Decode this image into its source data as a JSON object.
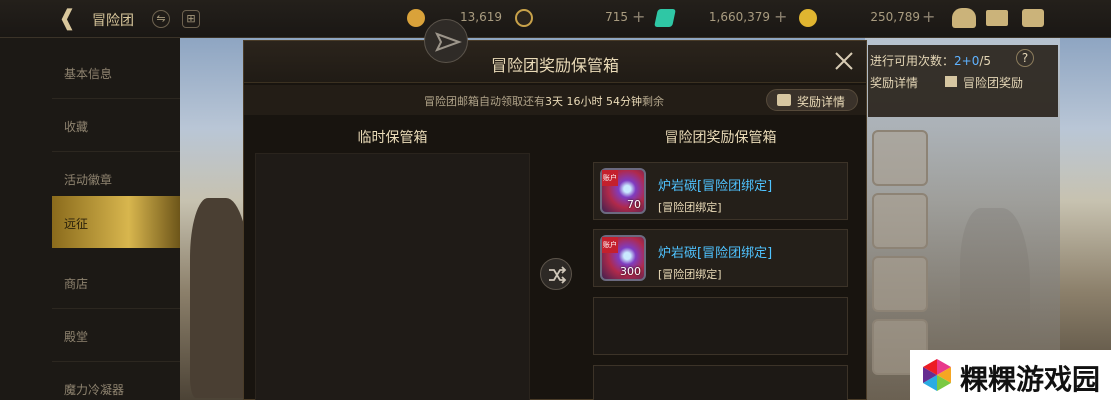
{
  "topbar": {
    "title": "冒险团",
    "currencies": [
      {
        "icon": "trophy-icon",
        "value": "13,619",
        "color": "#d9a23a"
      },
      {
        "icon": "coin-c-icon",
        "value": "715",
        "color": "#c8a24a"
      },
      {
        "icon": "crystal-icon",
        "value": "1,660,379",
        "color": "#2fc7a5"
      },
      {
        "icon": "gold-coin-icon",
        "value": "250,789",
        "color": "#e0b530"
      }
    ]
  },
  "menu": {
    "items": [
      "基本信息",
      "收藏",
      "活动徽章",
      "远征",
      "商店",
      "殿堂",
      "魔力冷凝器"
    ],
    "active_index": 3
  },
  "right_panel": {
    "usage_label": "进行可用次数：",
    "usage_current": "2",
    "usage_sep": "+",
    "usage_extra": "0",
    "usage_total": "/5",
    "help": "?",
    "reward_detail_btn": "奖励详情",
    "team_reward_btn": "冒险团奖励"
  },
  "modal": {
    "title": "冒险团奖励保管箱",
    "notice_prefix": "冒险团邮箱自动领取还有",
    "notice_days": "3天",
    "notice_hours": "16小时",
    "notice_minutes": "54分钟",
    "notice_suffix": "剩余",
    "detail_button": "奖励详情",
    "left_title": "临时保管箱",
    "right_title": "冒险团奖励保管箱",
    "items": [
      {
        "name": "炉岩碳[冒险团绑定]",
        "sub": "[冒险团绑定]",
        "count": "70",
        "tag": "账户"
      },
      {
        "name": "炉岩碳[冒险团绑定]",
        "sub": "[冒险团绑定]",
        "count": "300",
        "tag": "账户"
      }
    ]
  },
  "watermark": {
    "text": "粿粿游戏园"
  }
}
